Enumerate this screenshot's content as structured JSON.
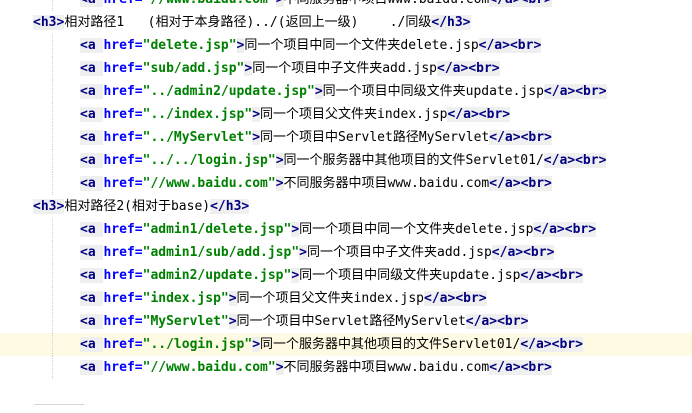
{
  "editor": {
    "lines": [
      {
        "indent": true,
        "parts": [
          {
            "t": "tag",
            "v": "<a "
          },
          {
            "t": "attr",
            "v": "href="
          },
          {
            "t": "str",
            "v": "\"//www.baidu.com\""
          },
          {
            "t": "tag",
            "v": ">"
          },
          {
            "t": "txt",
            "v": "不同服务器中项目www.baidu.com"
          },
          {
            "t": "tag",
            "v": "</a>"
          },
          {
            "t": "tag",
            "v": "<br>"
          }
        ]
      },
      {
        "indent": false,
        "parts": [
          {
            "t": "tag",
            "v": "<h3>"
          },
          {
            "t": "txt",
            "v": "相对路径1   (相对于本身路径)../(返回上一级)    ./同级"
          },
          {
            "t": "tag",
            "v": "</h3>"
          }
        ]
      },
      {
        "indent": true,
        "parts": [
          {
            "t": "tag",
            "v": "<a "
          },
          {
            "t": "attr",
            "v": "href="
          },
          {
            "t": "str",
            "v": "\"delete.jsp\""
          },
          {
            "t": "tag",
            "v": ">"
          },
          {
            "t": "txt",
            "v": "同一个项目中同一个文件夹delete.jsp"
          },
          {
            "t": "tag",
            "v": "</a>"
          },
          {
            "t": "tag",
            "v": "<br>"
          }
        ]
      },
      {
        "indent": true,
        "parts": [
          {
            "t": "tag",
            "v": "<a "
          },
          {
            "t": "attr",
            "v": "href="
          },
          {
            "t": "str",
            "v": "\"sub/add.jsp\""
          },
          {
            "t": "tag",
            "v": ">"
          },
          {
            "t": "txt",
            "v": "同一个项目中子文件夹add.jsp"
          },
          {
            "t": "tag",
            "v": "</a>"
          },
          {
            "t": "tag",
            "v": "<br>"
          }
        ]
      },
      {
        "indent": true,
        "parts": [
          {
            "t": "tag",
            "v": "<a "
          },
          {
            "t": "attr",
            "v": "href="
          },
          {
            "t": "str",
            "v": "\"../admin2/update.jsp\""
          },
          {
            "t": "tag",
            "v": ">"
          },
          {
            "t": "txt",
            "v": "同一个项目中同级文件夹update.jsp"
          },
          {
            "t": "tag",
            "v": "</a>"
          },
          {
            "t": "tag",
            "v": "<br>"
          }
        ]
      },
      {
        "indent": true,
        "parts": [
          {
            "t": "tag",
            "v": "<a "
          },
          {
            "t": "attr",
            "v": "href="
          },
          {
            "t": "str",
            "v": "\"../index.jsp\""
          },
          {
            "t": "tag",
            "v": ">"
          },
          {
            "t": "txt",
            "v": "同一个项目父文件夹index.jsp"
          },
          {
            "t": "tag",
            "v": "</a>"
          },
          {
            "t": "tag",
            "v": "<br>"
          }
        ]
      },
      {
        "indent": true,
        "parts": [
          {
            "t": "tag",
            "v": "<a "
          },
          {
            "t": "attr",
            "v": "href="
          },
          {
            "t": "str",
            "v": "\"../MyServlet\""
          },
          {
            "t": "tag",
            "v": ">"
          },
          {
            "t": "txt",
            "v": "同一个项目中Servlet路径MyServlet"
          },
          {
            "t": "tag",
            "v": "</a>"
          },
          {
            "t": "tag",
            "v": "<br>"
          }
        ]
      },
      {
        "indent": true,
        "parts": [
          {
            "t": "tag",
            "v": "<a "
          },
          {
            "t": "attr",
            "v": "href="
          },
          {
            "t": "str",
            "v": "\"../../login.jsp\""
          },
          {
            "t": "tag",
            "v": ">"
          },
          {
            "t": "txt",
            "v": "同一个服务器中其他项目的文件Servlet01/"
          },
          {
            "t": "tag",
            "v": "</a>"
          },
          {
            "t": "tag",
            "v": "<br>"
          }
        ]
      },
      {
        "indent": true,
        "parts": [
          {
            "t": "tag",
            "v": "<a "
          },
          {
            "t": "attr",
            "v": "href="
          },
          {
            "t": "str",
            "v": "\"//www.baidu.com\""
          },
          {
            "t": "tag",
            "v": ">"
          },
          {
            "t": "txt",
            "v": "不同服务器中项目www.baidu.com"
          },
          {
            "t": "tag",
            "v": "</a>"
          },
          {
            "t": "tag",
            "v": "<br>"
          }
        ]
      },
      {
        "indent": false,
        "parts": [
          {
            "t": "tag",
            "v": "<h3>"
          },
          {
            "t": "txt",
            "v": "相对路径2(相对于base)"
          },
          {
            "t": "tag",
            "v": "</h3>"
          }
        ]
      },
      {
        "indent": true,
        "parts": [
          {
            "t": "tag",
            "v": "<a "
          },
          {
            "t": "attr",
            "v": "href="
          },
          {
            "t": "str",
            "v": "\"admin1/delete.jsp\""
          },
          {
            "t": "tag",
            "v": ">"
          },
          {
            "t": "txt",
            "v": "同一个项目中同一个文件夹delete.jsp"
          },
          {
            "t": "tag",
            "v": "</a>"
          },
          {
            "t": "tag",
            "v": "<br>"
          }
        ]
      },
      {
        "indent": true,
        "parts": [
          {
            "t": "tag",
            "v": "<a "
          },
          {
            "t": "attr",
            "v": "href="
          },
          {
            "t": "str",
            "v": "\"admin1/sub/add.jsp\""
          },
          {
            "t": "tag",
            "v": ">"
          },
          {
            "t": "txt",
            "v": "同一个项目中子文件夹add.jsp"
          },
          {
            "t": "tag",
            "v": "</a>"
          },
          {
            "t": "tag",
            "v": "<br>"
          }
        ]
      },
      {
        "indent": true,
        "parts": [
          {
            "t": "tag",
            "v": "<a "
          },
          {
            "t": "attr",
            "v": "href="
          },
          {
            "t": "str",
            "v": "\"admin2/update.jsp\""
          },
          {
            "t": "tag",
            "v": ">"
          },
          {
            "t": "txt",
            "v": "同一个项目中同级文件夹update.jsp"
          },
          {
            "t": "tag",
            "v": "</a>"
          },
          {
            "t": "tag",
            "v": "<br>"
          }
        ]
      },
      {
        "indent": true,
        "parts": [
          {
            "t": "tag",
            "v": "<a "
          },
          {
            "t": "attr",
            "v": "href="
          },
          {
            "t": "str",
            "v": "\"index.jsp\""
          },
          {
            "t": "tag",
            "v": ">"
          },
          {
            "t": "txt",
            "v": "同一个项目父文件夹index.jsp"
          },
          {
            "t": "tag",
            "v": "</a>"
          },
          {
            "t": "tag",
            "v": "<br>"
          }
        ]
      },
      {
        "indent": true,
        "parts": [
          {
            "t": "tag",
            "v": "<a "
          },
          {
            "t": "attr",
            "v": "href="
          },
          {
            "t": "str",
            "v": "\"MyServlet\""
          },
          {
            "t": "tag",
            "v": ">"
          },
          {
            "t": "txt",
            "v": "同一个项目中Servlet路径MyServlet"
          },
          {
            "t": "tag",
            "v": "</a>"
          },
          {
            "t": "tag",
            "v": "<br>"
          }
        ]
      },
      {
        "indent": true,
        "current": true,
        "parts": [
          {
            "t": "tag",
            "v": "<a "
          },
          {
            "t": "attr",
            "v": "href="
          },
          {
            "t": "str",
            "v": "\"../login.jsp\""
          },
          {
            "t": "tag",
            "v": ">"
          },
          {
            "t": "txt",
            "v": "同一个服务器中其他项目的文件Servlet01/"
          },
          {
            "t": "tag",
            "v": "</a>"
          },
          {
            "t": "tag",
            "v": "<br>"
          }
        ]
      },
      {
        "indent": true,
        "parts": [
          {
            "t": "tag",
            "v": "<a "
          },
          {
            "t": "attr",
            "v": "href="
          },
          {
            "t": "str",
            "v": "\"//www.baidu.com\""
          },
          {
            "t": "tag",
            "v": ">"
          },
          {
            "t": "txt",
            "v": "不同服务器中项目www.baidu.com"
          },
          {
            "t": "tag",
            "v": "</a>"
          },
          {
            "t": "tag",
            "v": "<br>"
          }
        ]
      }
    ]
  },
  "colors": {
    "tag": "#000080",
    "attribute": "#0000ff",
    "string": "#008000",
    "current_line": "#fffae3",
    "tag_chip": "#efefef"
  }
}
